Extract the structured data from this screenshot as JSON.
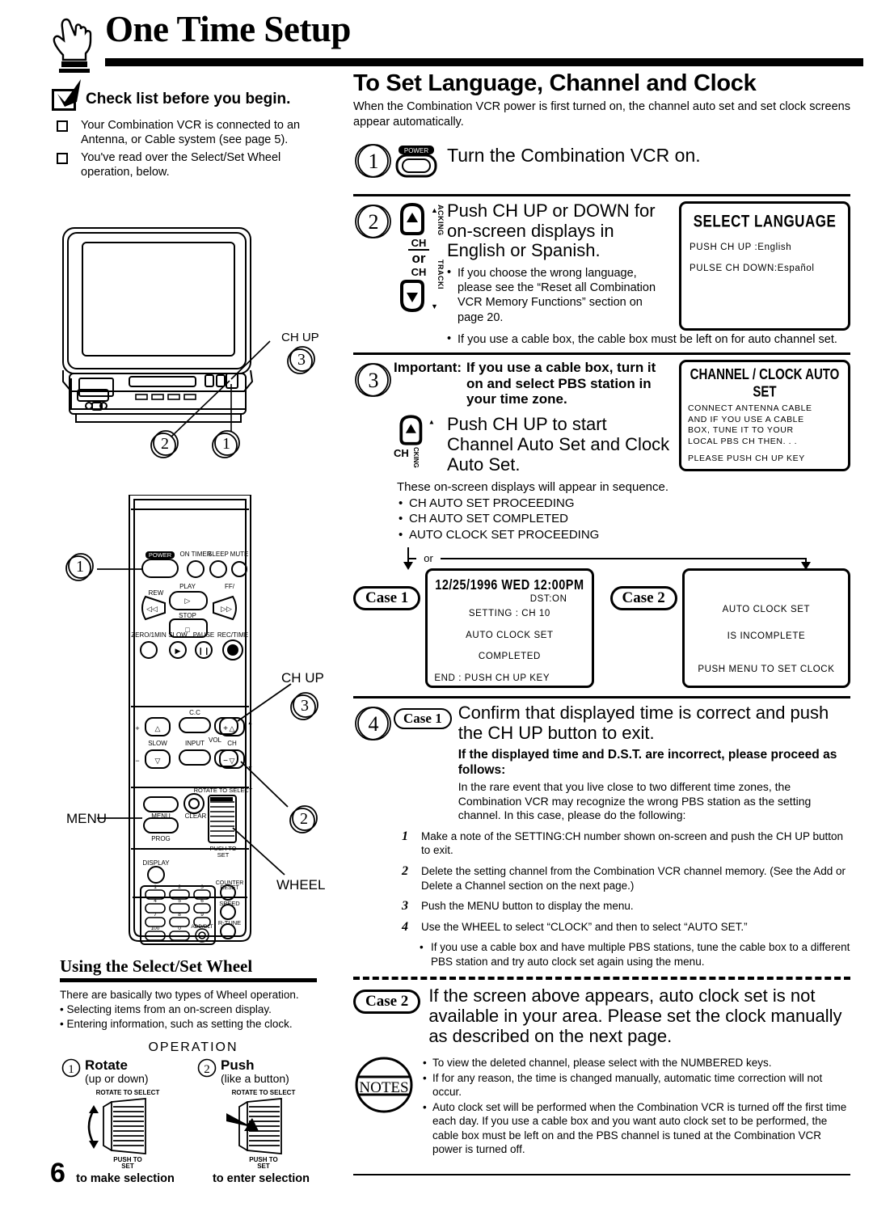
{
  "header": {
    "title": "One Time Setup",
    "hand_icon": "pointing-hand-icon"
  },
  "page_number": "6",
  "left": {
    "checklist": {
      "heading": "Check list before you begin.",
      "items": [
        "Your Combination VCR is connected to an Antenna, or Cable system (see page 5).",
        "You've read over the Select/Set Wheel operation, below."
      ]
    },
    "tv_illustration": {
      "label_ch_up": "CH UP",
      "callouts": [
        "1",
        "2",
        "3"
      ]
    },
    "remote_illustration": {
      "label_menu": "MENU",
      "label_ch_up": "CH UP",
      "label_wheel": "WHEEL",
      "callouts": [
        "1",
        "2",
        "3"
      ],
      "buttons": [
        "POWER",
        "ON TIMER",
        "SLEEP",
        "MUTE",
        "REW",
        "PLAY",
        "FF/",
        "STOP",
        "ZERO/1MIN",
        "SLOW",
        "PAUSE",
        "REC/TIME",
        "C.C",
        "INPUT",
        "VOL",
        "CH",
        "SLOW",
        "MENU",
        "CLEAR",
        "PROG",
        "DISPLAY",
        "ROTATE TO SELECT",
        "PUSH TO SET",
        "COUNTER RESET",
        "SPEED",
        "R-TUNE",
        "1",
        "2",
        "3",
        "4",
        "5",
        "6",
        "7",
        "8",
        "9",
        "100",
        "0",
        "ADD/DLT"
      ]
    },
    "wheel_section": {
      "title": "Using the Select/Set Wheel",
      "intro": "There are basically two types of Wheel operation.",
      "bullets": [
        "Selecting items from an on-screen display.",
        "Entering information, such as setting the clock."
      ],
      "operation_label": "OPERATION",
      "ops": [
        {
          "num": "1",
          "title": "Rotate",
          "sub": "(up or down)",
          "wheel_top": "ROTATE TO SELECT",
          "wheel_bottom": "PUSH TO SET",
          "foot": "to make selection"
        },
        {
          "num": "2",
          "title": "Push",
          "sub": "(like a button)",
          "wheel_top": "ROTATE TO SELECT",
          "wheel_bottom": "PUSH TO SET",
          "foot": "to enter selection"
        }
      ]
    }
  },
  "right": {
    "title": "To Set Language, Channel and Clock",
    "intro": "When the Combination VCR power is first turned on, the channel auto set and set clock screens appear automatically.",
    "step1": {
      "num": "1",
      "button_label": "POWER",
      "text": "Turn the Combination VCR on."
    },
    "step2": {
      "num": "2",
      "ch_label": "CH",
      "or_label": "or",
      "tracking_top": "ACKING",
      "tracking_bottom": "TRACKI",
      "text": "Push CH UP or DOWN for on-screen displays in English or Spanish.",
      "bullets": [
        "If you choose the wrong language, please see the “Reset all Combination VCR Memory Functions” section on page 20.",
        "If you use a cable box, the cable box must be left on for auto channel set."
      ],
      "osd": {
        "title": "SELECT LANGUAGE",
        "lines": [
          "PUSH CH UP    :English",
          "PULSE  CH  DOWN:Español"
        ]
      }
    },
    "step3": {
      "num": "3",
      "important_label": "Important:",
      "important_text": "If you use a cable box, turn it on and select PBS station in your time zone.",
      "ch_label": "CH",
      "tracking": "CKING",
      "text": "Push CH UP to start Channel Auto Set and Clock Auto Set.",
      "osd": {
        "title": "CHANNEL / CLOCK AUTO SET",
        "lines": [
          "CONNECT  ANTENNA CABLE",
          "AND  IF YOU USE A CABLE",
          "BOX, TUNE  IT TO YOUR",
          "LOCAL PBS CH    THEN. . .",
          "",
          "PLEASE PUSH CH UP KEY"
        ]
      }
    },
    "sequence": {
      "intro": "These on-screen displays will appear in sequence.",
      "items": [
        "CH AUTO SET PROCEEDING",
        "CH AUTO SET COMPLETED",
        "AUTO CLOCK SET PROCEEDING"
      ],
      "branch_label": "or"
    },
    "case1_screen": {
      "label": "Case 1",
      "lines": [
        "12/25/1996 WED 12:00PM",
        "DST:ON",
        "SETTING : CH 10",
        "AUTO CLOCK SET",
        "COMPLETED",
        "END : PUSH CH UP KEY"
      ]
    },
    "case2_screen": {
      "label": "Case 2",
      "lines": [
        "AUTO CLOCK SET",
        "IS INCOMPLETE",
        "PUSH MENU TO SET CLOCK"
      ]
    },
    "step4": {
      "num": "4",
      "case_label": "Case 1",
      "text": "Confirm that displayed time is correct and push the CH UP button to exit.",
      "bold_heading": "If the displayed time and D.S.T. are incorrect, please proceed as follows:",
      "body": "In the rare event that you live close to two different time zones, the Combination VCR may recognize the wrong PBS station as the setting channel. In this case, please do the following:",
      "numbered": [
        {
          "n": "1",
          "text": "Make a note of the SETTING:CH number shown on-screen and push the CH UP button to exit."
        },
        {
          "n": "2",
          "text": "Delete the setting channel from the Combination VCR channel memory. (See the Add or Delete a Channel section on the next page.)"
        },
        {
          "n": "3",
          "text": "Push the MENU button to display the menu."
        },
        {
          "n": "4",
          "text": "Use the WHEEL to select “CLOCK” and then to select “AUTO SET.”"
        }
      ],
      "sub_bullet": "If you use a cable box and have multiple PBS stations, tune the cable box to a different PBS station and try auto clock set again using the menu."
    },
    "case2_block": {
      "label": "Case 2",
      "text": "If the screen above appears, auto clock set is not available in your area. Please set the clock manually as described on the next page."
    },
    "notes": {
      "badge": "NOTES",
      "items": [
        "To view the deleted channel, please select with the NUMBERED keys.",
        "If for any reason, the time is changed manually, automatic time correction will not occur.",
        "Auto clock set will be performed when the Combination VCR is turned off the first time each day. If you use a cable box and you want auto clock set to be performed, the cable box must be left on and the PBS channel is tuned at the Combination VCR power is turned off."
      ]
    }
  }
}
